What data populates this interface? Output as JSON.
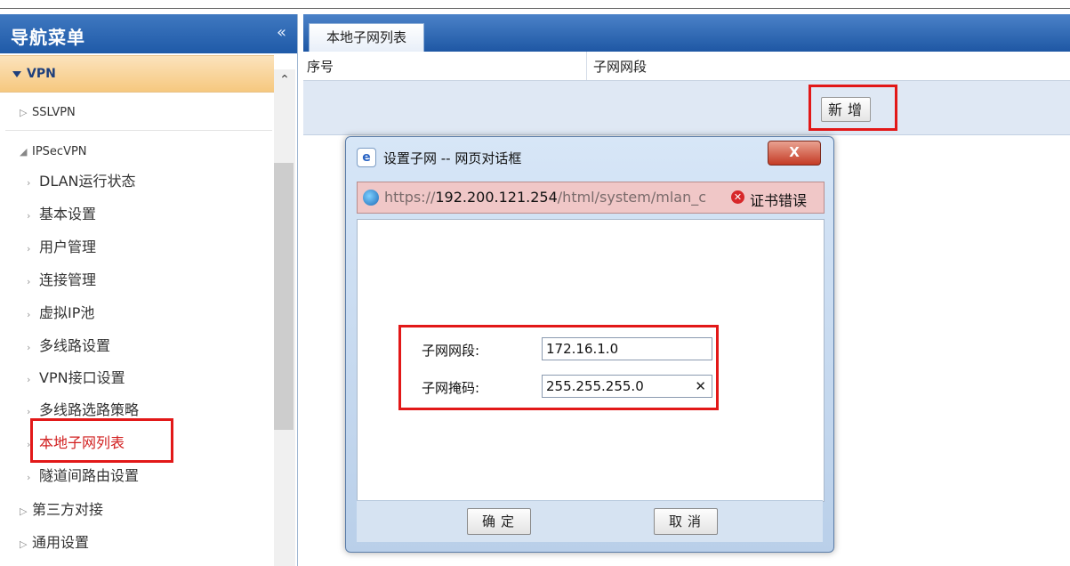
{
  "sidebar": {
    "title": "导航菜单",
    "collapse_glyph": "«",
    "section": "VPN",
    "scroll_up_glyph": "⌃",
    "items": [
      {
        "label": "SSLVPN",
        "marker": "▷"
      },
      {
        "label": "IPSecVPN",
        "marker": "◢"
      },
      {
        "label": "DLAN运行状态",
        "marker": "›"
      },
      {
        "label": "基本设置",
        "marker": "›"
      },
      {
        "label": "用户管理",
        "marker": "›"
      },
      {
        "label": "连接管理",
        "marker": "›"
      },
      {
        "label": "虚拟IP池",
        "marker": "›"
      },
      {
        "label": "多线路设置",
        "marker": "›"
      },
      {
        "label": "VPN接口设置",
        "marker": "›"
      },
      {
        "label": "多线路选路策略",
        "marker": "›"
      },
      {
        "label": "本地子网列表",
        "marker": "›"
      },
      {
        "label": "隧道间路由设置",
        "marker": "›"
      },
      {
        "label": "第三方对接",
        "marker": "▷"
      },
      {
        "label": "通用设置",
        "marker": "▷"
      }
    ]
  },
  "main": {
    "tab": "本地子网列表",
    "columns": [
      "序号",
      "子网网段"
    ],
    "add_button": "新增"
  },
  "dialog": {
    "icon": "e",
    "title": "设置子网 -- 网页对话框",
    "close_glyph": "X",
    "url_prefix": "https://",
    "url_host": "192.200.121.254",
    "url_path": "/html/system/mlan_c",
    "cert_icon": "✕",
    "cert_error": "证书错误",
    "fields": [
      {
        "label": "子网网段:",
        "value": "172.16.1.0"
      },
      {
        "label": "子网掩码:",
        "value": "255.255.255.0",
        "clear_glyph": "✕"
      }
    ],
    "ok": "确定",
    "cancel": "取消"
  }
}
